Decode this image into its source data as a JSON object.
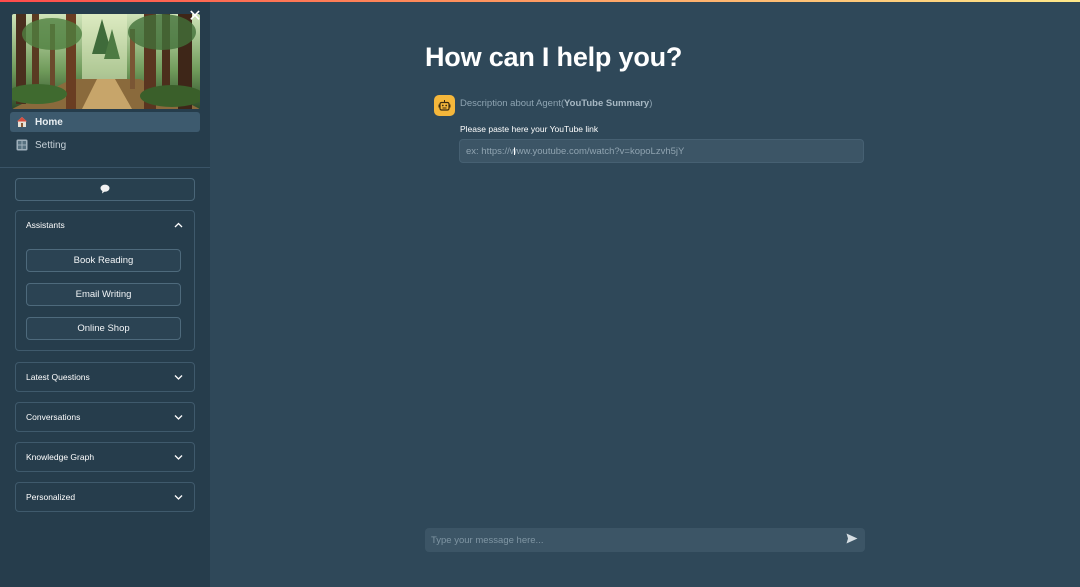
{
  "sidebar": {
    "nav": [
      {
        "label": "Home",
        "icon": "home-icon",
        "active": true
      },
      {
        "label": "Setting",
        "icon": "grid-icon",
        "active": false
      }
    ],
    "chat_button_icon": "speech-bubble-icon",
    "assistants": {
      "title": "Assistants",
      "expanded": true,
      "items": [
        "Book Reading",
        "Email Writing",
        "Online Shop"
      ]
    },
    "sections": [
      {
        "title": "Latest Questions",
        "expanded": false
      },
      {
        "title": "Conversations",
        "expanded": false
      },
      {
        "title": "Knowledge Graph",
        "expanded": false
      },
      {
        "title": "Personalized",
        "expanded": false
      }
    ]
  },
  "main": {
    "title": "How can I help you?",
    "agent": {
      "desc_prefix": "Description about Agent(",
      "desc_name": "YouTube Summary",
      "desc_suffix": ")",
      "icon": "robot-icon"
    },
    "youtube": {
      "label": "Please paste here your YouTube link",
      "placeholder": "ex: https://www.youtube.com/watch?v=kopoLzvh5jY"
    },
    "chat": {
      "placeholder": "Type your message here...",
      "send_icon": "send-icon"
    }
  },
  "colors": {
    "background": "#2f4859",
    "sidebar": "#263d4c",
    "agent_icon_bg": "#f5b73b",
    "input_bg": "#3c5566"
  }
}
